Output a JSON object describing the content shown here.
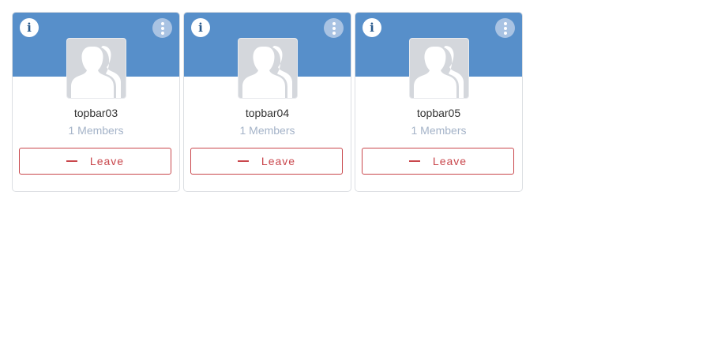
{
  "colors": {
    "header": "#578fca",
    "leave": "#c9474c"
  },
  "cards": [
    {
      "name": "topbar03",
      "members": "1 Members",
      "leave_label": "Leave"
    },
    {
      "name": "topbar04",
      "members": "1 Members",
      "leave_label": "Leave"
    },
    {
      "name": "topbar05",
      "members": "1 Members",
      "leave_label": "Leave"
    }
  ],
  "icons": {
    "info": "i"
  }
}
